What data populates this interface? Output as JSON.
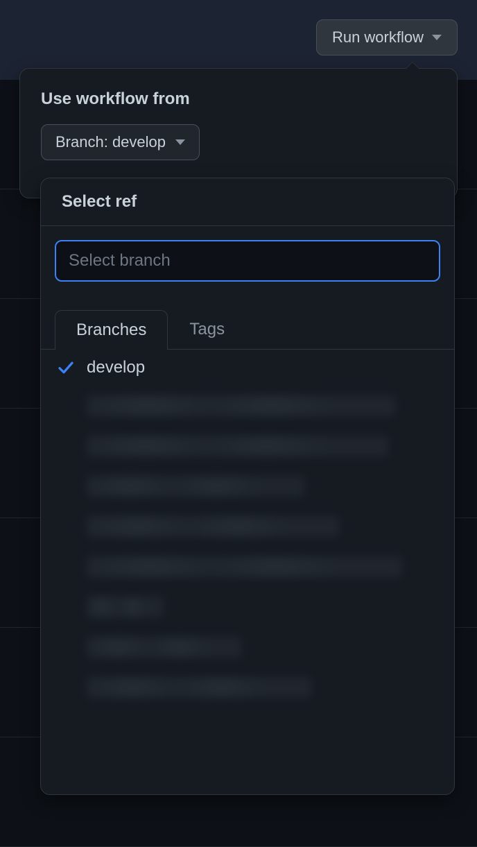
{
  "header": {
    "run_workflow_label": "Run workflow"
  },
  "panel": {
    "title": "Use workflow from",
    "branch_selector_prefix": "Branch: ",
    "branch_selector_value": "develop"
  },
  "ref_picker": {
    "title": "Select ref",
    "search_placeholder": "Select branch",
    "tabs": [
      {
        "label": "Branches",
        "active": true
      },
      {
        "label": "Tags",
        "active": false
      }
    ],
    "selected_branch": "develop",
    "blurred_branch_count": 8,
    "blurred_widths": [
      88,
      86,
      62,
      72,
      90,
      22,
      44,
      64,
      90
    ]
  }
}
